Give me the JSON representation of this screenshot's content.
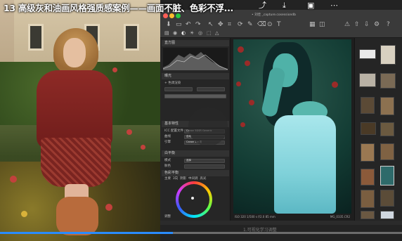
{
  "video": {
    "title": "13 高级灰和油画风格强质感案例——画面不脏、色彩不浮...",
    "progress": 0.43,
    "colors": {
      "progress_fill": "#2a8cff",
      "progress_track": "#6c6c6c"
    }
  },
  "top_icons": [
    "share-icon",
    "download-icon",
    "picture-in-picture-icon",
    "more-icon"
  ],
  "app": {
    "document_name": "• 刘佳 _capture.cosessiondb",
    "panel": {
      "histogram_header": "直方图",
      "row1": "曝光",
      "row2": "+ 色调渲染",
      "basic_header": "基本特性",
      "icc_label": "ICC 配置文件",
      "icc_value": "Canon 5DSR Generic",
      "curve_label": "曲线",
      "curve_value": "自动",
      "engine_label": "引擎",
      "engine_value": "Canon 1.x 次",
      "wb_header": "白平衡",
      "mode_label": "模式",
      "mode_value": "选择",
      "skin_label": "肤色",
      "color_balance_header": "色彩平衡",
      "color_tabs": [
        "主要",
        "3向",
        "阴影",
        "中间调",
        "高光"
      ],
      "footer_label": "调整"
    },
    "viewer_status_left": "ISO 320  1/500 s  f/2.0  85 mm",
    "viewer_status_right": "MG_0335.CR2"
  },
  "watermark": "1.可视化学习调整"
}
